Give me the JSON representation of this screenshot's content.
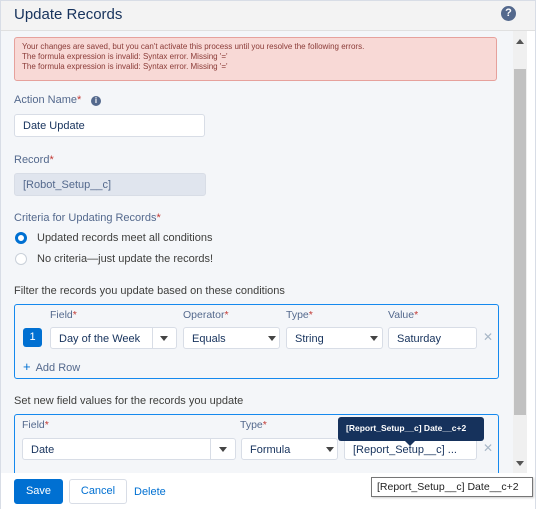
{
  "header": {
    "title": "Update Records",
    "help_icon": "help-icon"
  },
  "error": {
    "lines": [
      "Your changes are saved, but you can't activate this process until you resolve the following errors.",
      "The formula expression is invalid: Syntax error. Missing '='",
      "The formula expression is invalid: Syntax error. Missing '='"
    ]
  },
  "action_name": {
    "label": "Action Name",
    "required": "*",
    "value": "Date Update"
  },
  "record": {
    "label": "Record",
    "required": "*",
    "value": "[Robot_Setup__c]"
  },
  "criteria": {
    "label": "Criteria for Updating Records",
    "required": "*",
    "options": [
      {
        "label": "Updated records meet all conditions",
        "selected": true
      },
      {
        "label": "No criteria—just update the records!",
        "selected": false
      }
    ]
  },
  "filter": {
    "heading": "Filter the records you update based on these conditions",
    "columns": {
      "field": "Field",
      "operator": "Operator",
      "type": "Type",
      "value": "Value"
    },
    "row": {
      "number": "1",
      "field": "Day of the Week",
      "operator": "Equals",
      "type": "String",
      "value": "Saturday"
    },
    "add_row": "Add Row"
  },
  "set_values": {
    "heading": "Set new field values for the records you update",
    "columns": {
      "field": "Field",
      "type": "Type"
    },
    "row": {
      "field": "Date",
      "type": "Formula",
      "value": "[Report_Setup__c] ..."
    },
    "tooltip": "[Report_Setup__c] Date__c+2"
  },
  "footer": {
    "save": "Save",
    "cancel": "Cancel",
    "delete": "Delete"
  },
  "hover_tip": "[Report_Setup__c] Date__c+2",
  "colors": {
    "brand": "#0070d2",
    "error_bg": "#f8d9d6",
    "tooltip_bg": "#16325c"
  }
}
